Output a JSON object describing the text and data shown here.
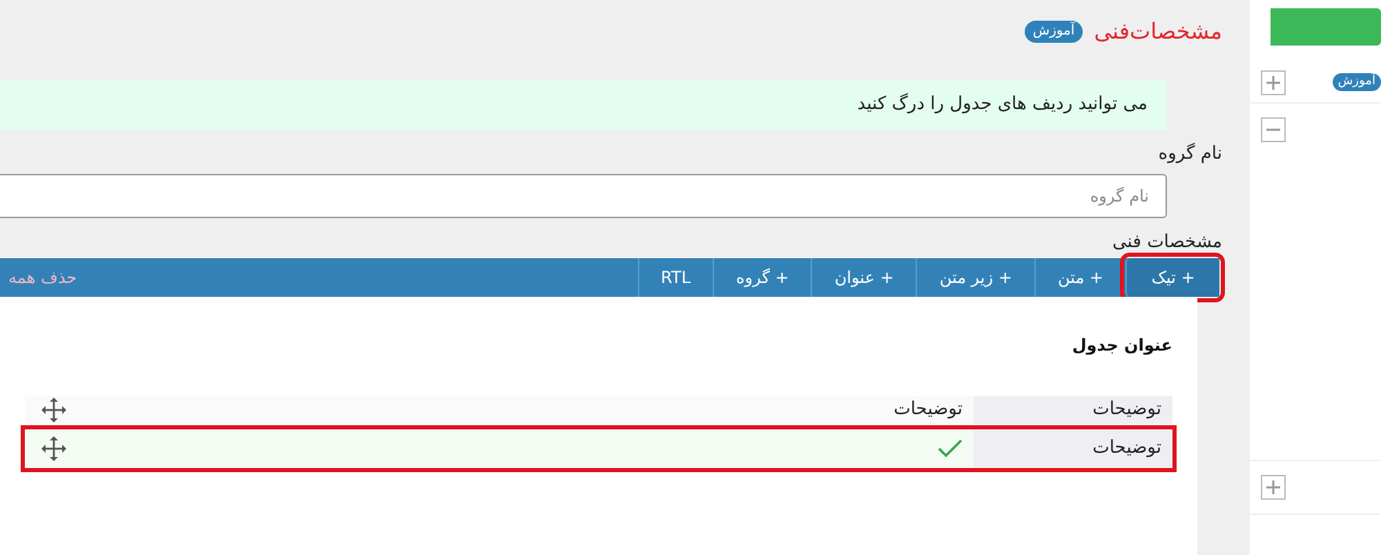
{
  "header": {
    "title": "مشخصات‌فنی",
    "badge": "آموزش"
  },
  "notice": "می توانید ردیف های جدول را درگ کنید",
  "group_name": {
    "label": "نام گروه",
    "placeholder": "نام گروه"
  },
  "specs_label": "مشخصات فنی",
  "toolbar": {
    "buttons": [
      {
        "label": "+ تیک",
        "highlighted": true
      },
      {
        "label": "+ متن",
        "highlighted": false
      },
      {
        "label": "+ زیر متن",
        "highlighted": false
      },
      {
        "label": "+ عنوان",
        "highlighted": false
      },
      {
        "label": "+ گروه",
        "highlighted": false
      },
      {
        "label": "RTL",
        "highlighted": false
      }
    ],
    "delete_all": "حذف همه"
  },
  "table": {
    "title": "عنوان جدول",
    "rows": [
      {
        "kind": "text",
        "label": "توضیحات",
        "value": "توضیحات",
        "highlighted": false
      },
      {
        "kind": "check",
        "label": "توضیحات",
        "highlighted": true
      }
    ]
  },
  "sidebar": {
    "badge": "آموزش"
  }
}
